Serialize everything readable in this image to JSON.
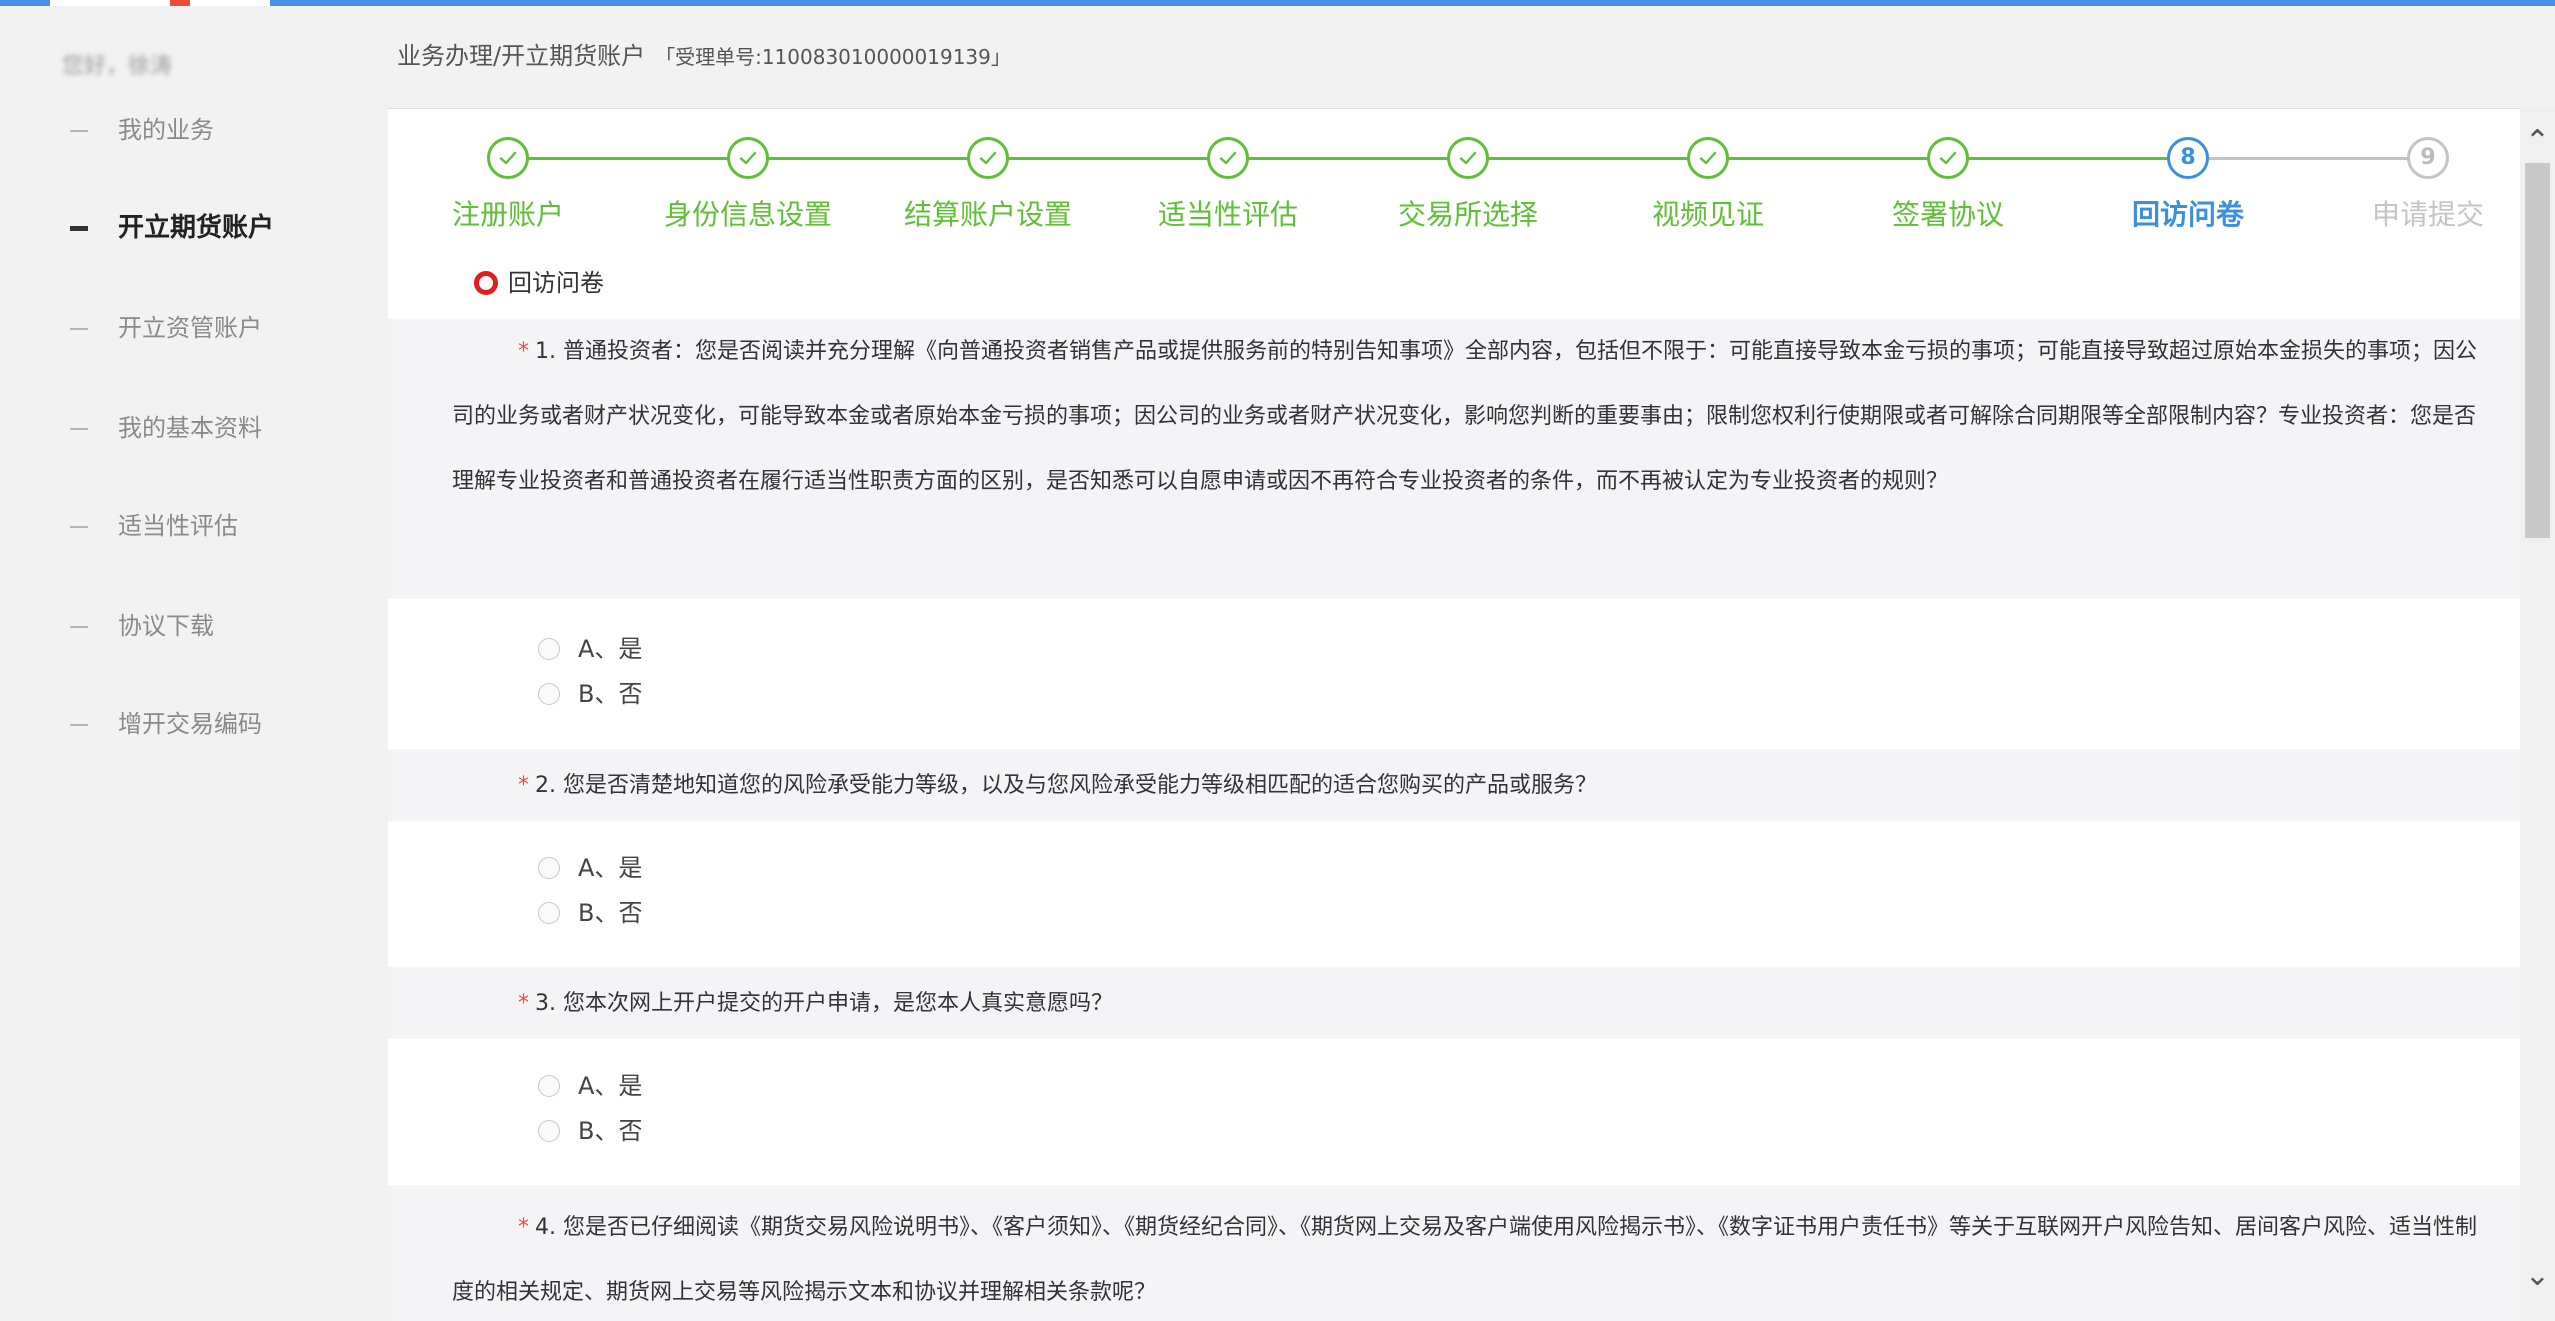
{
  "sidebar": {
    "greeting": "您好，徐涛",
    "items": [
      {
        "label": "我的业务"
      },
      {
        "label": "开立期货账户"
      },
      {
        "label": "开立资管账户"
      },
      {
        "label": "我的基本资料"
      },
      {
        "label": "适当性评估"
      },
      {
        "label": "协议下载"
      },
      {
        "label": "增开交易编码"
      }
    ],
    "active_index": 1
  },
  "header": {
    "breadcrumb": "业务办理/开立期货账户",
    "order": "「受理单号:110083010000019139」"
  },
  "steps": [
    {
      "label": "注册账户",
      "status": "done"
    },
    {
      "label": "身份信息设置",
      "status": "done"
    },
    {
      "label": "结算账户设置",
      "status": "done"
    },
    {
      "label": "适当性评估",
      "status": "done"
    },
    {
      "label": "交易所选择",
      "status": "done"
    },
    {
      "label": "视频见证",
      "status": "done"
    },
    {
      "label": "签署协议",
      "status": "done"
    },
    {
      "label": "回访问卷",
      "status": "current",
      "number": "8"
    },
    {
      "label": "申请提交",
      "status": "pending",
      "number": "9"
    }
  ],
  "section_title": "回访问卷",
  "questions": [
    {
      "required": "*",
      "text": "1. 普通投资者：您是否阅读并充分理解《向普通投资者销售产品或提供服务前的特别告知事项》全部内容，包括但不限于：可能直接导致本金亏损的事项；可能直接导致超过原始本金损失的事项；因公司的业务或者财产状况变化，可能导致本金或者原始本金亏损的事项；因公司的业务或者财产状况变化，影响您判断的重要事由；限制您权利行使期限或者可解除合同期限等全部限制内容？专业投资者：您是否理解专业投资者和普通投资者在履行适当性职责方面的区别，是否知悉可以自愿申请或因不再符合专业投资者的条件，而不再被认定为专业投资者的规则？",
      "options": [
        "A、是",
        "B、否"
      ]
    },
    {
      "required": "*",
      "text": "2. 您是否清楚地知道您的风险承受能力等级，以及与您风险承受能力等级相匹配的适合您购买的产品或服务？",
      "options": [
        "A、是",
        "B、否"
      ]
    },
    {
      "required": "*",
      "text": "3. 您本次网上开户提交的开户申请，是您本人真实意愿吗？",
      "options": [
        "A、是",
        "B、否"
      ]
    },
    {
      "required": "*",
      "text": "4. 您是否已仔细阅读《期货交易风险说明书》、《客户须知》、《期货经纪合同》、《期货网上交易及客户端使用风险揭示书》、《数字证书用户责任书》等关于互联网开户风险告知、居间客户风险、适当性制度的相关规定、期货网上交易等风险揭示文本和协议并理解相关条款呢？",
      "options": []
    }
  ],
  "colors": {
    "done": "#5fbf36",
    "current": "#3b8fe0",
    "pending": "#c4c4c4",
    "required": "#e94b4b",
    "section_marker": "#e01e1e"
  }
}
